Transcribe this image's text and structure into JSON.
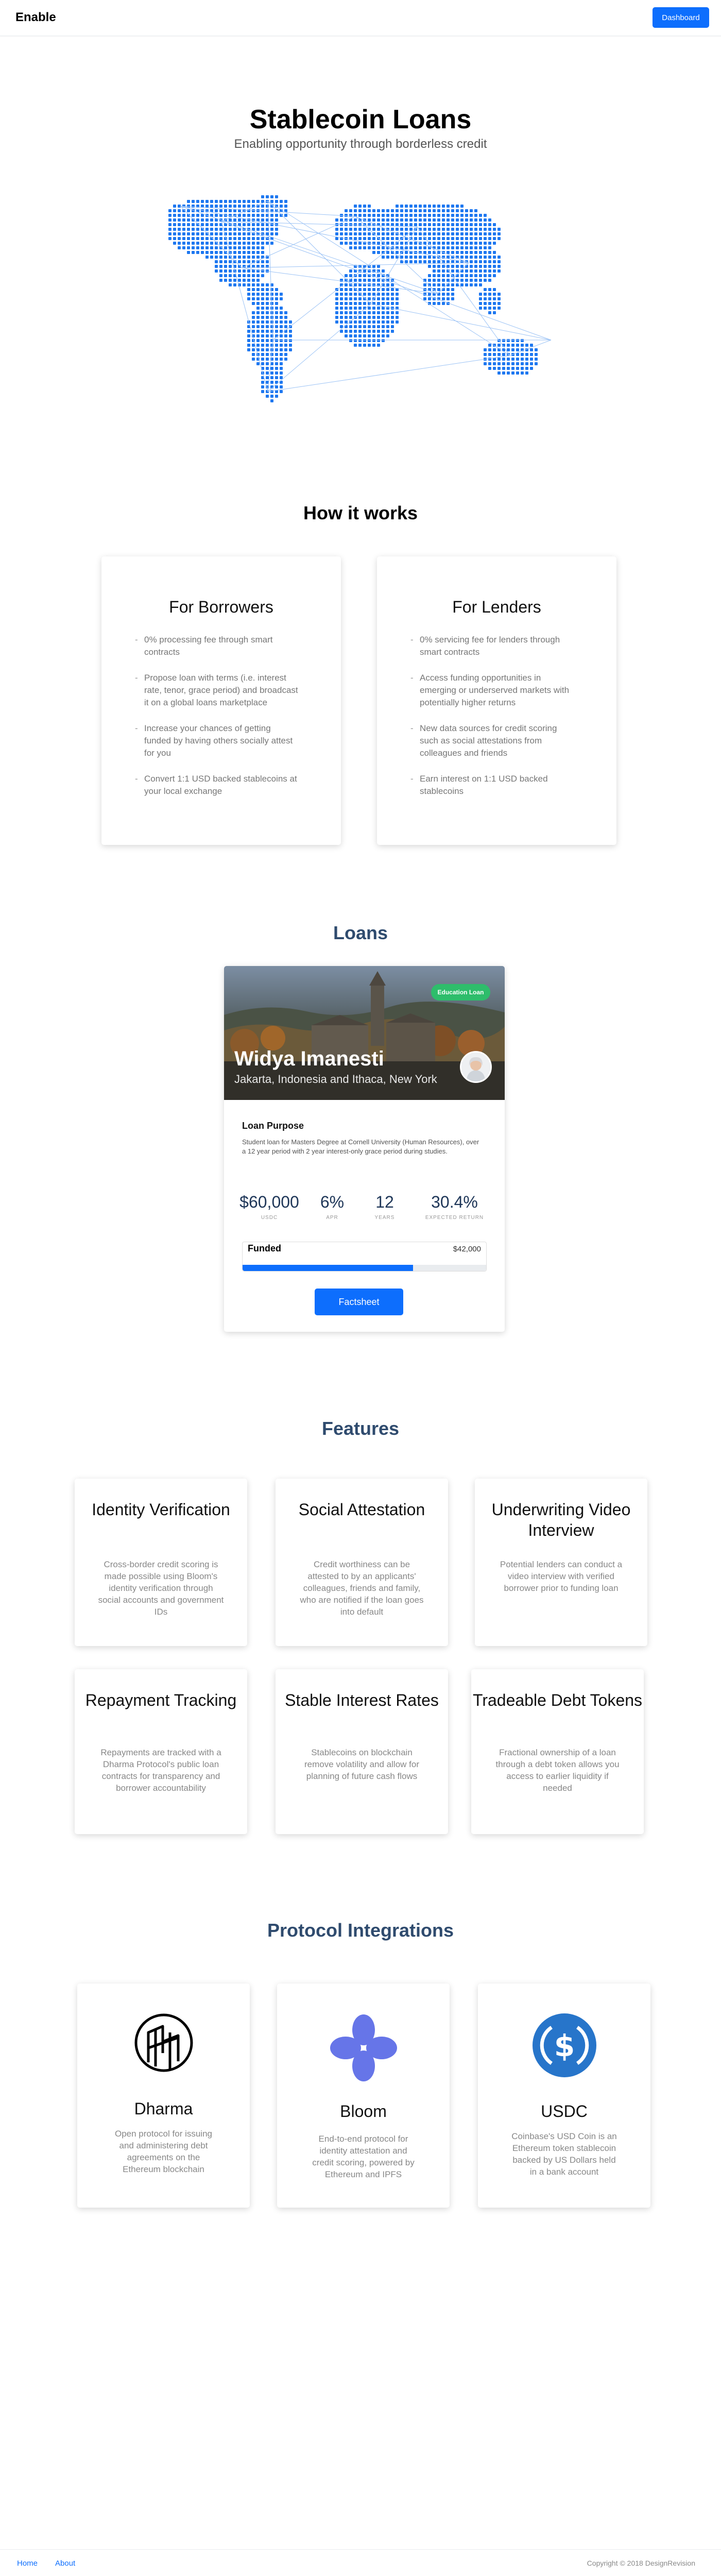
{
  "nav": {
    "brand": "Enable",
    "dashboard_label": "Dashboard"
  },
  "hero": {
    "title": "Stablecoin Loans",
    "subtitle": "Enabling opportunity through borderless credit"
  },
  "how_it_works": {
    "title": "How it works",
    "borrowers": {
      "title": "For Borrowers",
      "items": [
        "0% processing fee through smart contracts",
        "Propose loan with terms (i.e. interest rate, tenor, grace period) and broadcast it on a global loans marketplace",
        "Increase your chances of getting funded by having others socially attest for you",
        "Convert 1:1 USD backed stablecoins at your local exchange"
      ]
    },
    "lenders": {
      "title": "For Lenders",
      "items": [
        "0% servicing fee for lenders through smart contracts",
        "Access funding opportunities in emerging or underserved markets with potentially higher returns",
        "New data sources for credit scoring such as social attestations from colleagues and friends",
        "Earn interest on 1:1 USD backed stablecoins"
      ]
    }
  },
  "loans": {
    "title": "Loans",
    "card": {
      "badge": "Education Loan",
      "name": "Widya Imanesti",
      "location": "Jakarta, Indonesia and Ithaca, New York",
      "purpose_heading": "Loan Purpose",
      "purpose_text": "Student loan for Masters Degree at Cornell University (Human Resources), over a 12 year period with 2 year interest-only grace period during studies.",
      "stats": [
        {
          "value": "$60,000",
          "label": "USDC"
        },
        {
          "value": "6%",
          "label": "APR"
        },
        {
          "value": "12",
          "label": "YEARS"
        },
        {
          "value": "30.4%",
          "label": "EXPECTED RETURN"
        }
      ],
      "funded_label": "Funded",
      "funded_amount": "$42,000",
      "funded_fraction": 0.7,
      "button_label": "Factsheet"
    }
  },
  "features": {
    "title": "Features",
    "items": [
      {
        "title": "Identity Verification",
        "desc": "Cross-border credit scoring is made possible using Bloom's identity verification through social accounts and government IDs"
      },
      {
        "title": "Social Attestation",
        "desc": "Credit worthiness can be attested to by an applicants' colleagues, friends and family, who are notified if the loan goes into default"
      },
      {
        "title": "Underwriting Video Interview",
        "desc": "Potential lenders can conduct a video interview with verified borrower prior to funding loan"
      },
      {
        "title": "Repayment Tracking",
        "desc": "Repayments are tracked with a Dharma Protocol's public loan contracts for transparency and borrower accountability"
      },
      {
        "title": "Stable Interest Rates",
        "desc": "Stablecoins on blockchain remove volatility and allow for planning of future cash flows"
      },
      {
        "title": "Tradeable Debt Tokens",
        "desc": "Fractional ownership of a loan through a debt token allows you access to earlier liquidity if needed"
      }
    ]
  },
  "protocols": {
    "title": "Protocol Integrations",
    "items": [
      {
        "name": "Dharma",
        "desc": "Open protocol for issuing and administering debt agreements on the Ethereum blockchain",
        "icon": "dharma-icon"
      },
      {
        "name": "Bloom",
        "desc": "End-to-end protocol for identity attestation and credit scoring, powered by Ethereum and IPFS",
        "icon": "bloom-icon"
      },
      {
        "name": "USDC",
        "desc": "Coinbase's USD Coin is an Ethereum token stablecoin backed by US Dollars held in a bank account",
        "icon": "usdc-icon"
      }
    ]
  },
  "colors": {
    "accent": "#0d6efd",
    "navy": "#2f4b6e",
    "badge": "#2ebd6b",
    "map_dots": "#1f78f0"
  },
  "footer": {
    "links": [
      "Home",
      "About"
    ],
    "copyright": "Copyright © 2018 DesignRevision"
  }
}
